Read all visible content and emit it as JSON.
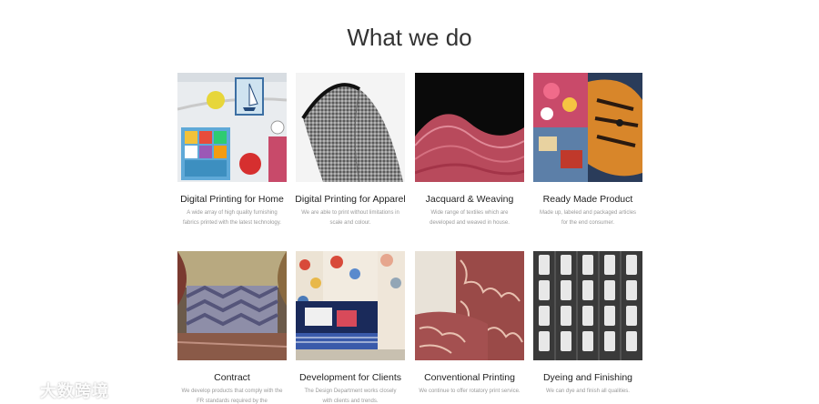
{
  "section": {
    "title": "What we do"
  },
  "services": [
    {
      "title": "Digital Printing for Home",
      "desc": "A wide array of high quality furnishing fabrics printed with the latest technology."
    },
    {
      "title": "Digital Printing for Apparel",
      "desc": "We are able to print without limitations in scale and colour."
    },
    {
      "title": "Jacquard & Weaving",
      "desc": "Wide range of textiles which are developed and weaved in house."
    },
    {
      "title": "Ready Made Product",
      "desc": "Made up, labeled and packaged articles for the end consumer."
    },
    {
      "title": "Contract",
      "desc": "We develop products that comply with the FR standards required by the"
    },
    {
      "title": "Development for Clients",
      "desc": "The Design Department works closely with clients and trends."
    },
    {
      "title": "Conventional Printing",
      "desc": "We continue to offer rotatory print service."
    },
    {
      "title": "Dyeing and Finishing",
      "desc": "We can dye and finish all qualities."
    }
  ],
  "watermark": {
    "text": "大数跨境"
  }
}
